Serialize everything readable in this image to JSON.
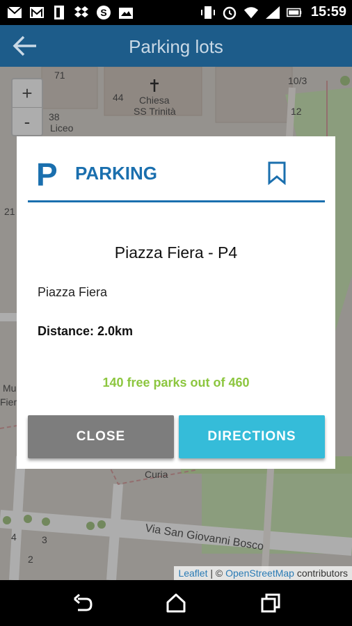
{
  "status_bar": {
    "time": "15:59",
    "left_icons": [
      "mail-icon",
      "gmail-icon",
      "phone-icon",
      "dropbox-icon",
      "skype-icon",
      "gallery-icon"
    ],
    "right_icons": [
      "vibrate-icon",
      "alarm-icon",
      "wifi-icon",
      "signal-icon",
      "battery-icon"
    ]
  },
  "app_bar": {
    "title": "Parking lots"
  },
  "map": {
    "zoom_in": "+",
    "zoom_out": "-",
    "labels": {
      "church": "Chiesa",
      "church_sub": "SS Trinità",
      "liceo": "Liceo",
      "street": "Via San Giovanni Bosco",
      "curia": "Curia",
      "n71": "71",
      "n44": "44",
      "n38": "38",
      "n12": "12",
      "n10_3": "10/3",
      "n21": "21",
      "n4": "4",
      "n3": "3",
      "n2": "2",
      "mus": "Mu",
      "fier": "Fier"
    },
    "attribution": {
      "leaflet": "Leaflet",
      "separator": " | © ",
      "osm": "OpenStreetMap",
      "contributors": " contributors"
    }
  },
  "dialog": {
    "icon_letter": "P",
    "title": "PARKING",
    "name": "Piazza Fiera - P4",
    "address": "Piazza Fiera",
    "distance": "Distance: 2.0km",
    "availability": "140 free parks out of 460",
    "close_label": "CLOSE",
    "directions_label": "DIRECTIONS",
    "colors": {
      "accent": "#1a6fae",
      "availability": "#8cc63f",
      "directions": "#35bcd9",
      "close": "#7d7d7d"
    }
  },
  "nav_bar": {
    "icons": [
      "back-icon",
      "home-icon",
      "recents-icon"
    ]
  }
}
